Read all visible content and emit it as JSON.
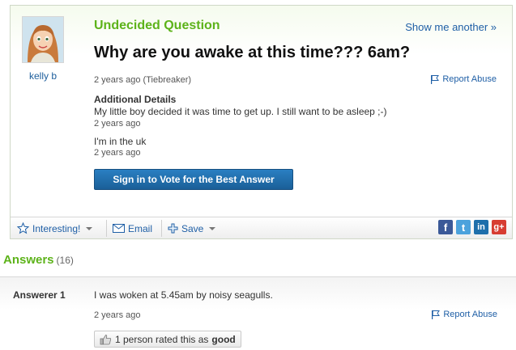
{
  "question": {
    "user_name": "kelly b",
    "type_label": "Undecided Question",
    "show_another": "Show me another »",
    "title": "Why are you awake at this time??? 6am?",
    "meta": "2 years ago (Tiebreaker)",
    "report_abuse": "Report Abuse",
    "additional_heading": "Additional Details",
    "details": [
      {
        "text": "My little boy decided it was time to get up. I still want to be asleep ;-)",
        "meta": "2 years ago"
      },
      {
        "text": "I'm in the uk",
        "meta": "2 years ago"
      }
    ],
    "vote_button": "Sign in to Vote for the Best Answer"
  },
  "toolbar": {
    "interesting": "Interesting!",
    "email": "Email",
    "save": "Save",
    "social": [
      {
        "icon": "facebook-icon",
        "glyph": "f",
        "color": "#3b5998"
      },
      {
        "icon": "twitter-icon",
        "glyph": "t",
        "color": "#4ca2dc"
      },
      {
        "icon": "linkedin-icon",
        "glyph": "in",
        "color": "#1e6fab"
      },
      {
        "icon": "google-plus-icon",
        "glyph": "g+",
        "color": "#d73d32"
      }
    ]
  },
  "answers": {
    "heading": "Answers",
    "count": "(16)",
    "items": [
      {
        "answerer": "Answerer 1",
        "text": "I was woken at 5.45am by noisy seagulls.",
        "meta": "2 years ago",
        "report_abuse": "Report Abuse",
        "rated_prefix": "1 person rated this as",
        "rated_value": "good"
      }
    ]
  },
  "colors": {
    "accent_green": "#5db31a",
    "link_blue": "#1f5fa6",
    "button_blue": "#1a6aa8"
  }
}
